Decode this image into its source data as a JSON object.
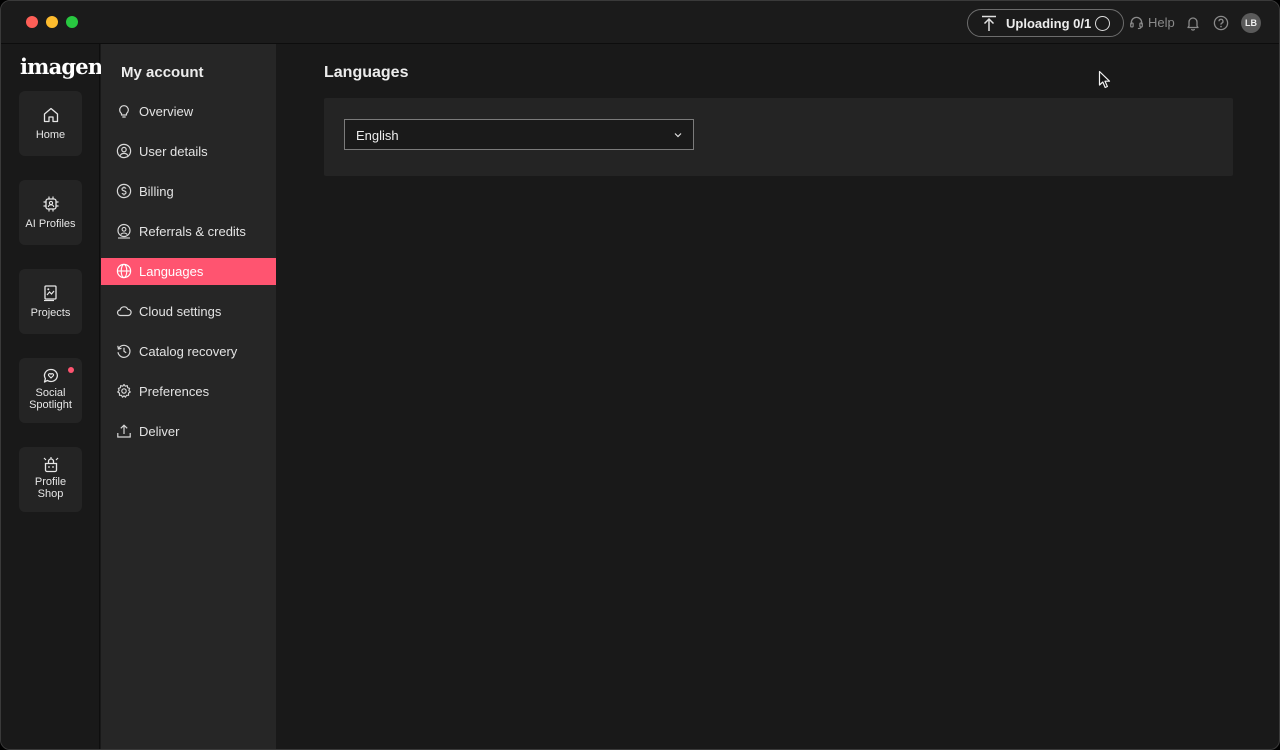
{
  "window": {
    "upload_status": "Uploading 0/1",
    "help_label": "Help",
    "avatar_initials": "LB"
  },
  "rail": {
    "logo": "imagen",
    "items": [
      {
        "label": "Home",
        "icon": "home-icon"
      },
      {
        "label": "AI Profiles",
        "icon": "ai-chip-icon"
      },
      {
        "label": "Projects",
        "icon": "projects-icon"
      },
      {
        "label": "Social Spotlight",
        "icon": "chat-heart-icon",
        "notification": true
      },
      {
        "label": "Profile Shop",
        "icon": "shop-icon"
      }
    ]
  },
  "sidebar": {
    "title": "My account",
    "items": [
      {
        "label": "Overview",
        "icon": "lightbulb-icon"
      },
      {
        "label": "User details",
        "icon": "user-circle-icon"
      },
      {
        "label": "Billing",
        "icon": "dollar-circle-icon"
      },
      {
        "label": "Referrals & credits",
        "icon": "referral-icon"
      },
      {
        "label": "Languages",
        "icon": "globe-icon",
        "active": true
      },
      {
        "label": "Cloud settings",
        "icon": "cloud-icon"
      },
      {
        "label": "Catalog recovery",
        "icon": "history-icon"
      },
      {
        "label": "Preferences",
        "icon": "gear-icon"
      },
      {
        "label": "Deliver",
        "icon": "upload-icon"
      }
    ]
  },
  "main": {
    "title": "Languages",
    "language_select": {
      "value": "English"
    }
  },
  "colors": {
    "accent": "#ff5470",
    "background": "#191919",
    "sidebar": "#262626",
    "card": "#242424"
  }
}
